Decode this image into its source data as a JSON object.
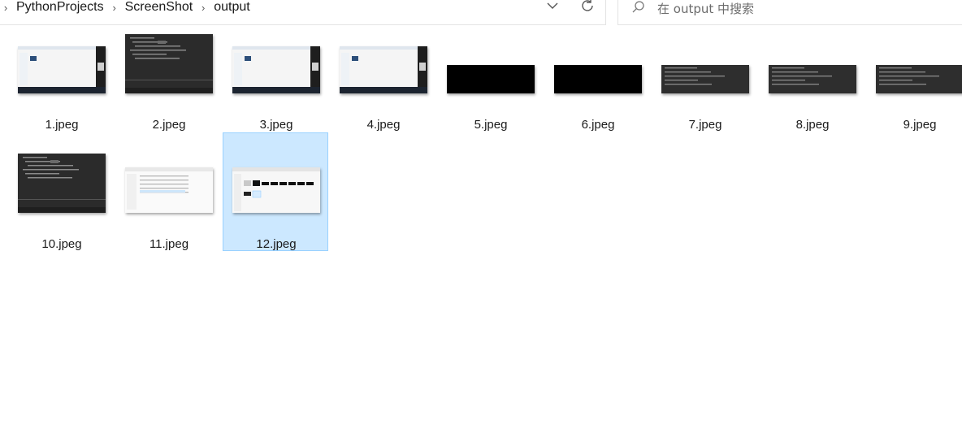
{
  "breadcrumb": {
    "items": [
      "PythonProjects",
      "ScreenShot",
      "output"
    ]
  },
  "search": {
    "placeholder": "在 output 中搜索"
  },
  "icons": {
    "chevron": "chevron-down-icon",
    "refresh": "refresh-icon",
    "search": "search-icon",
    "separator": "chevron-right-icon"
  },
  "colors": {
    "selection_bg": "#cce8ff",
    "selection_border": "#99d1ff"
  },
  "files": [
    {
      "name": "1.jpeg",
      "thumb": "desktop"
    },
    {
      "name": "2.jpeg",
      "thumb": "code-dark-tall"
    },
    {
      "name": "3.jpeg",
      "thumb": "desktop"
    },
    {
      "name": "4.jpeg",
      "thumb": "desktop"
    },
    {
      "name": "5.jpeg",
      "thumb": "black"
    },
    {
      "name": "6.jpeg",
      "thumb": "black"
    },
    {
      "name": "7.jpeg",
      "thumb": "code-dark"
    },
    {
      "name": "8.jpeg",
      "thumb": "code-dark"
    },
    {
      "name": "9.jpeg",
      "thumb": "code-dark"
    },
    {
      "name": "10.jpeg",
      "thumb": "code-dark-tall"
    },
    {
      "name": "11.jpeg",
      "thumb": "explorer-light"
    },
    {
      "name": "12.jpeg",
      "thumb": "explorer-thumbs",
      "selected": true
    }
  ]
}
